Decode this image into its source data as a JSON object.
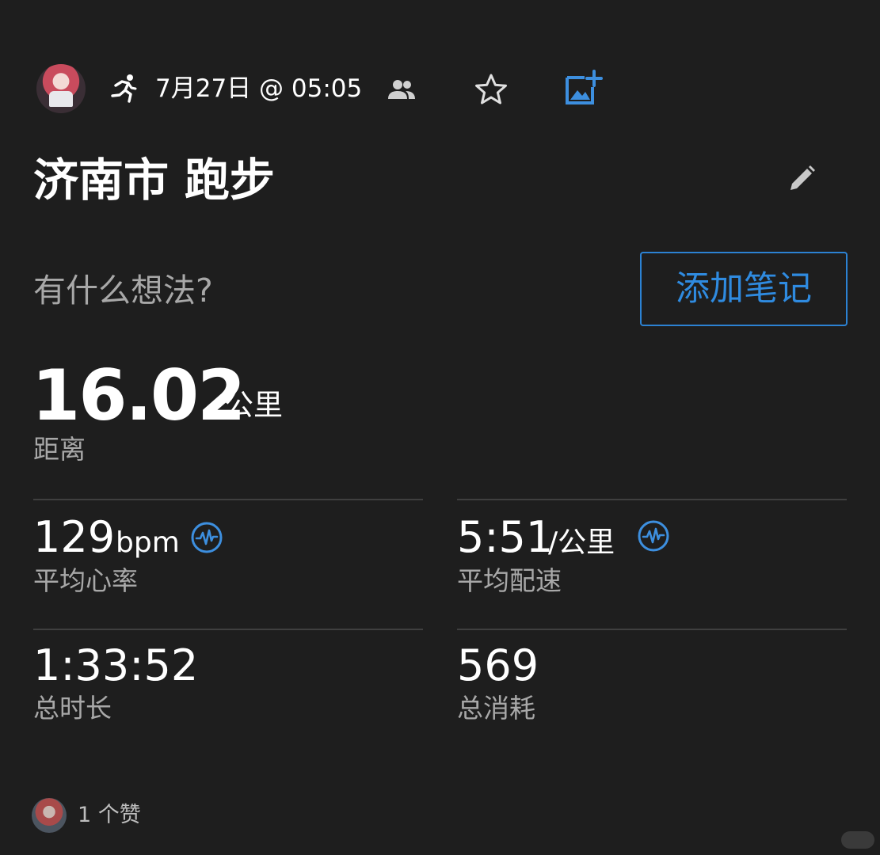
{
  "header": {
    "date": "7月27日 @ 05:05",
    "activity_icon": "running-icon",
    "privacy_icon": "people-icon",
    "favorite_icon": "star-outline-icon",
    "add_photo_icon": "add-photo-icon"
  },
  "title": "济南市 跑步",
  "notes": {
    "prompt": "有什么想法?",
    "button_label": "添加笔记"
  },
  "distance": {
    "value": "16.02",
    "unit": "公里",
    "label": "距离"
  },
  "stats": {
    "heart_rate": {
      "value": "129",
      "unit": "bpm",
      "label": "平均心率",
      "icon": "pulse-icon"
    },
    "pace": {
      "value": "5:51",
      "unit": "/公里",
      "label": "平均配速",
      "icon": "pulse-icon"
    },
    "duration": {
      "value": "1:33:52",
      "label": "总时长"
    },
    "calories": {
      "value": "569",
      "label": "总消耗"
    }
  },
  "likes": {
    "text": "1 个赞"
  },
  "colors": {
    "background": "#1e1e1e",
    "accent": "#2f8be0",
    "secondary_text": "#a8a8a8"
  }
}
